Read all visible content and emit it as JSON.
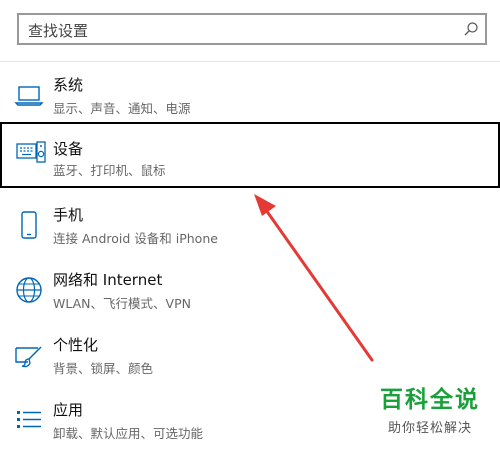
{
  "search": {
    "placeholder": "查找设置"
  },
  "items": [
    {
      "title": "系统",
      "sub": "显示、声音、通知、电源",
      "icon": "laptop-icon"
    },
    {
      "title": "设备",
      "sub": "蓝牙、打印机、鼠标",
      "icon": "keyboard-speaker-icon"
    },
    {
      "title": "手机",
      "sub": "连接 Android 设备和 iPhone",
      "icon": "phone-icon"
    },
    {
      "title": "网络和 Internet",
      "sub": "WLAN、飞行模式、VPN",
      "icon": "globe-icon"
    },
    {
      "title": "个性化",
      "sub": "背景、锁屏、颜色",
      "icon": "paintbrush-icon"
    },
    {
      "title": "应用",
      "sub": "卸载、默认应用、可选功能",
      "icon": "apps-list-icon"
    }
  ],
  "watermark": {
    "main": "百科全说",
    "sub": "助你轻松解决"
  },
  "colors": {
    "accent": "#0067b8",
    "arrow": "#e53935",
    "selected_border": "#000000",
    "watermark": "#1aa03a"
  }
}
